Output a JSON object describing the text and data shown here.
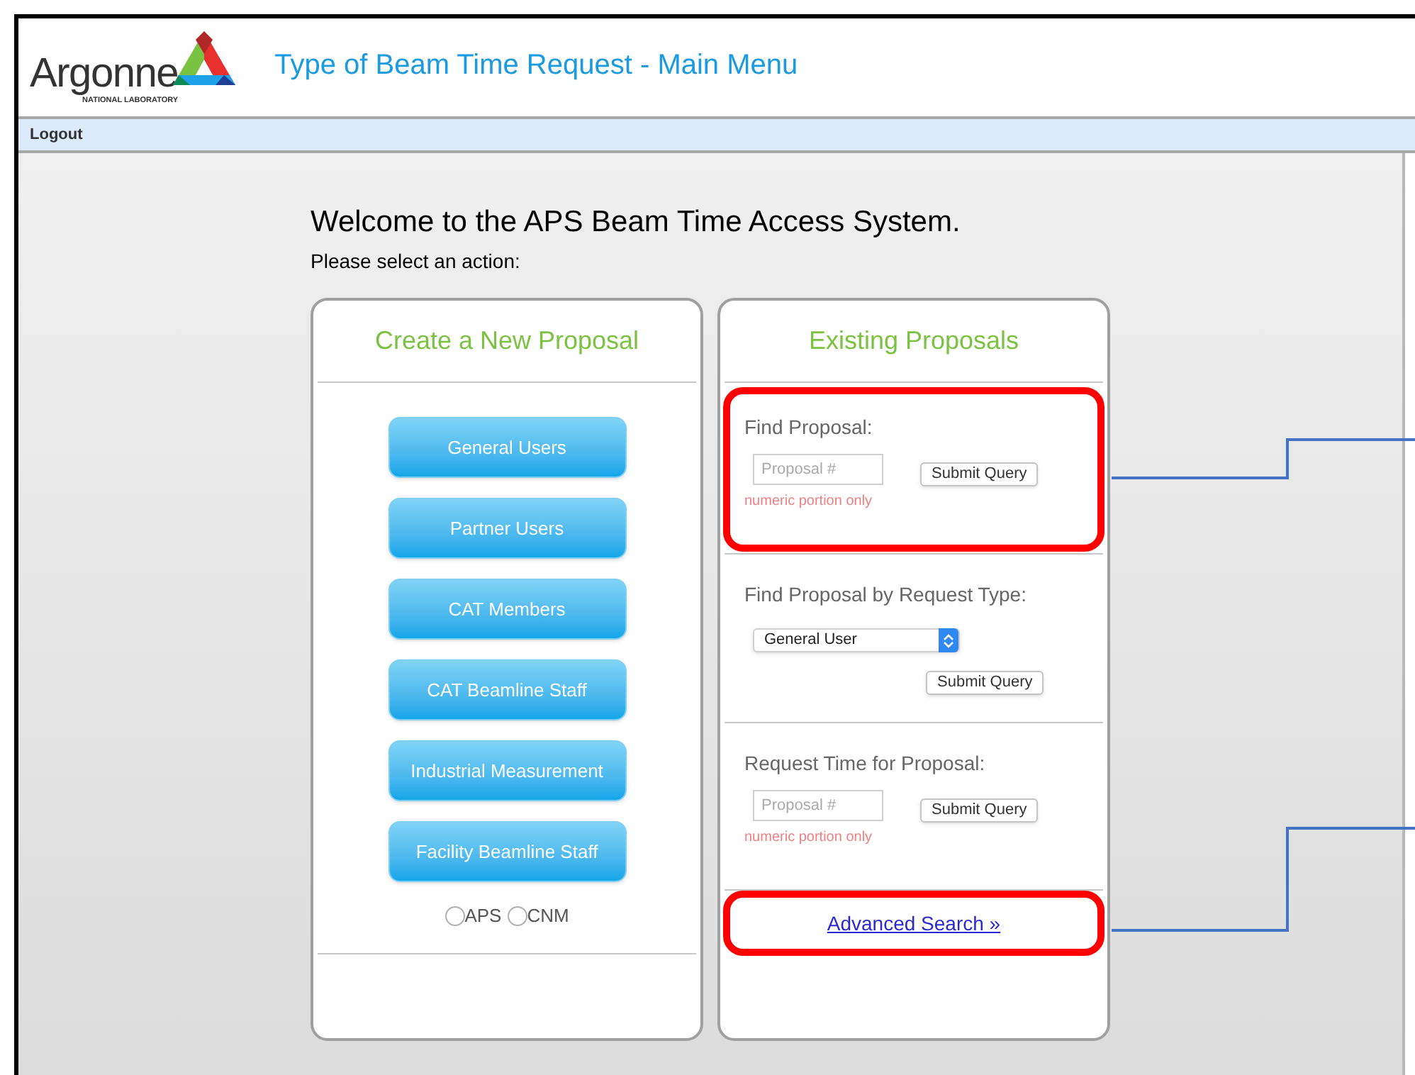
{
  "header": {
    "logo_name": "Argonne",
    "logo_subtitle": "NATIONAL LABORATORY",
    "title": "Type of Beam Time Request - Main Menu"
  },
  "nav": {
    "items": [
      "Logout"
    ]
  },
  "welcome": "Welcome to the APS Beam Time Access System.",
  "prompt": "Please select an action:",
  "create_panel": {
    "title": "Create a New Proposal",
    "buttons": [
      "General Users",
      "Partner Users",
      "CAT Members",
      "CAT Beamline Staff",
      "Industrial Measurement",
      "Facility Beamline Staff"
    ],
    "radios": [
      {
        "label": "APS",
        "selected": false
      },
      {
        "label": "CNM",
        "selected": false
      }
    ]
  },
  "existing_panel": {
    "title": "Existing Proposals",
    "sections": [
      {
        "kind": "lookup",
        "label": "Find Proposal:",
        "placeholder": "Proposal #",
        "button": "Submit Query",
        "hint": "numeric portion only",
        "highlighted": true
      },
      {
        "kind": "select",
        "label": "Find Proposal by Request Type:",
        "value": "General User",
        "button": "Submit Query",
        "highlighted": false
      },
      {
        "kind": "lookup",
        "label": "Request Time for Proposal:",
        "placeholder": "Proposal #",
        "button": "Submit Query",
        "hint": "numeric portion only",
        "highlighted": false
      },
      {
        "kind": "link",
        "link": "Advanced Search »",
        "highlighted": true
      }
    ]
  }
}
